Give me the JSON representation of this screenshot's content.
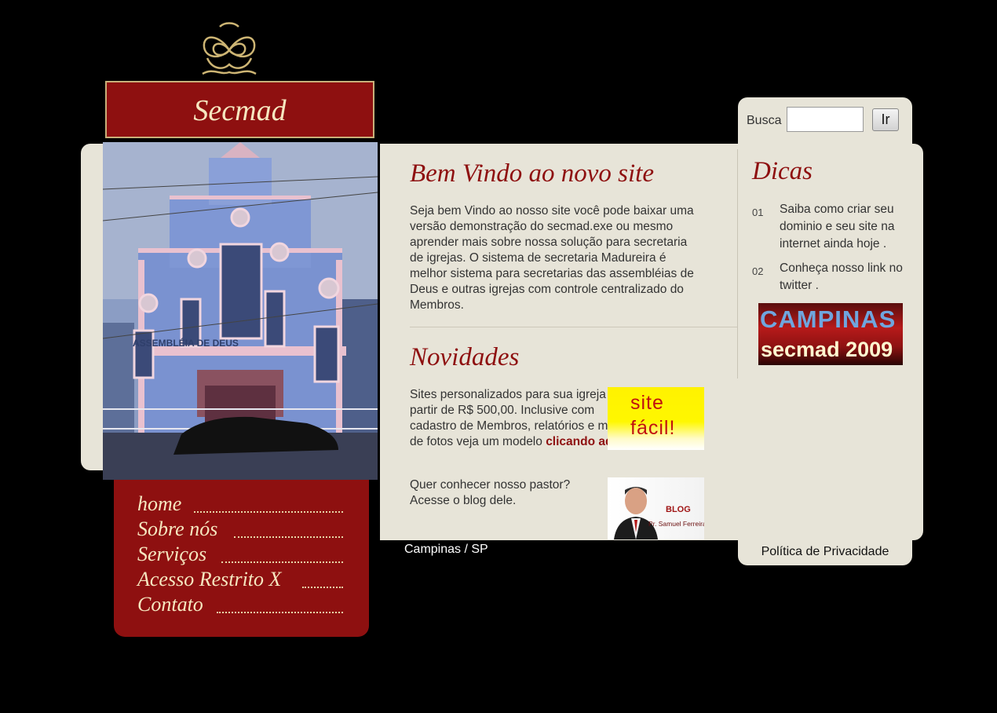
{
  "brand": {
    "name": "Secmad"
  },
  "search": {
    "label": "Busca",
    "value": "",
    "button_label": "Ir"
  },
  "nav": {
    "items": [
      {
        "label": "home"
      },
      {
        "label": "Sobre nós"
      },
      {
        "label": "Serviços"
      },
      {
        "label": "Acesso Restrito X"
      },
      {
        "label": "Contato"
      }
    ]
  },
  "main": {
    "welcome_title": "Bem Vindo ao novo site",
    "welcome_text": "Seja bem Vindo ao nosso site você pode baixar uma versão demonstração do secmad.exe ou mesmo aprender mais sobre nossa solução para secretaria de igrejas. O sistema de secretaria Madureira é melhor sistema para secretarias das assembléias de Deus e outras igrejas com controle centralizado do Membros.",
    "news_title": "Novidades",
    "news1_text": "Sites personalizados para sua igreja a partir de R$ 500,00. Inclusive com cadastro de Membros, relatórios e mural de fotos veja um modelo",
    "news1_link": "clicando aqui",
    "news2_text": "Quer conhecer nosso pastor? Acesse o blog dele.",
    "sitefacil_line1": "site",
    "sitefacil_line2": "fácil!",
    "church_sign": "ASSEMBLÉIA DE DEUS",
    "blog_label": "BLOG",
    "blog_name": "Pr. Samuel Ferreira"
  },
  "sidebar": {
    "title": "Dicas",
    "tips": [
      {
        "num": "01",
        "text": "Saiba como criar seu dominio e seu site na internet ainda hoje ."
      },
      {
        "num": "02",
        "text": "Conheça nosso link no twitter ."
      }
    ],
    "banner_line1": "CAMPINAS",
    "banner_line2": "secmad 2009"
  },
  "footer": {
    "location": "Campinas / SP",
    "privacy": "Política de Privacidade"
  },
  "colors": {
    "brand_red": "#8e1010",
    "cream": "#e7e4d8",
    "gold": "#c8b07a"
  }
}
